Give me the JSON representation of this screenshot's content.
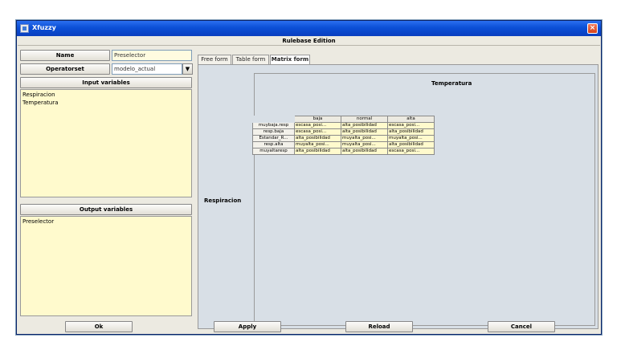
{
  "window": {
    "title": "Xfuzzy",
    "close_label": "×"
  },
  "header": {
    "title": "Rulebase Edition"
  },
  "form": {
    "name_label": "Name",
    "name_value": "Preselector",
    "operatorset_label": "Operatorset",
    "operatorset_value": "modelo_actual",
    "dropdown_arrow": "▼"
  },
  "input_variables": {
    "title": "Input variables",
    "items": [
      "Respiracion",
      "Temperatura"
    ]
  },
  "output_variables": {
    "title": "Output variables",
    "items": [
      "Preselector"
    ]
  },
  "tabs": [
    {
      "label": "Free form",
      "active": false
    },
    {
      "label": "Table form",
      "active": false
    },
    {
      "label": "Matrix form",
      "active": true
    }
  ],
  "matrix": {
    "column_variable": "Temperatura",
    "row_variable": "Respiracion",
    "columns": [
      "baja",
      "normal",
      "alta"
    ],
    "rows": [
      {
        "label": "muybaja.resp",
        "cells": [
          "escasa_posi...",
          "alta_posibilidad",
          "escasa_posi..."
        ]
      },
      {
        "label": "resp.baja",
        "cells": [
          "escasa_posi...",
          "alta_posibilidad",
          "alta_posibilidad"
        ]
      },
      {
        "label": "Estandar_R...",
        "cells": [
          "alta_posibilidad",
          "muyalta_posi...",
          "muyalta_posi..."
        ]
      },
      {
        "label": "resp.alta",
        "cells": [
          "muyalta_posi...",
          "muyalta_posi...",
          "alta_posibilidad"
        ]
      },
      {
        "label": "muyaltaresp",
        "cells": [
          "alta_posibilidad",
          "alta_posibilidad",
          "escasa_posi..."
        ]
      }
    ]
  },
  "buttons": {
    "ok": "Ok",
    "apply": "Apply",
    "reload": "Reload",
    "cancel": "Cancel"
  },
  "colors": {
    "titlebar": "#0b4fd6",
    "list_bg": "#fffacd",
    "panel_bg": "#d8dfe6"
  }
}
